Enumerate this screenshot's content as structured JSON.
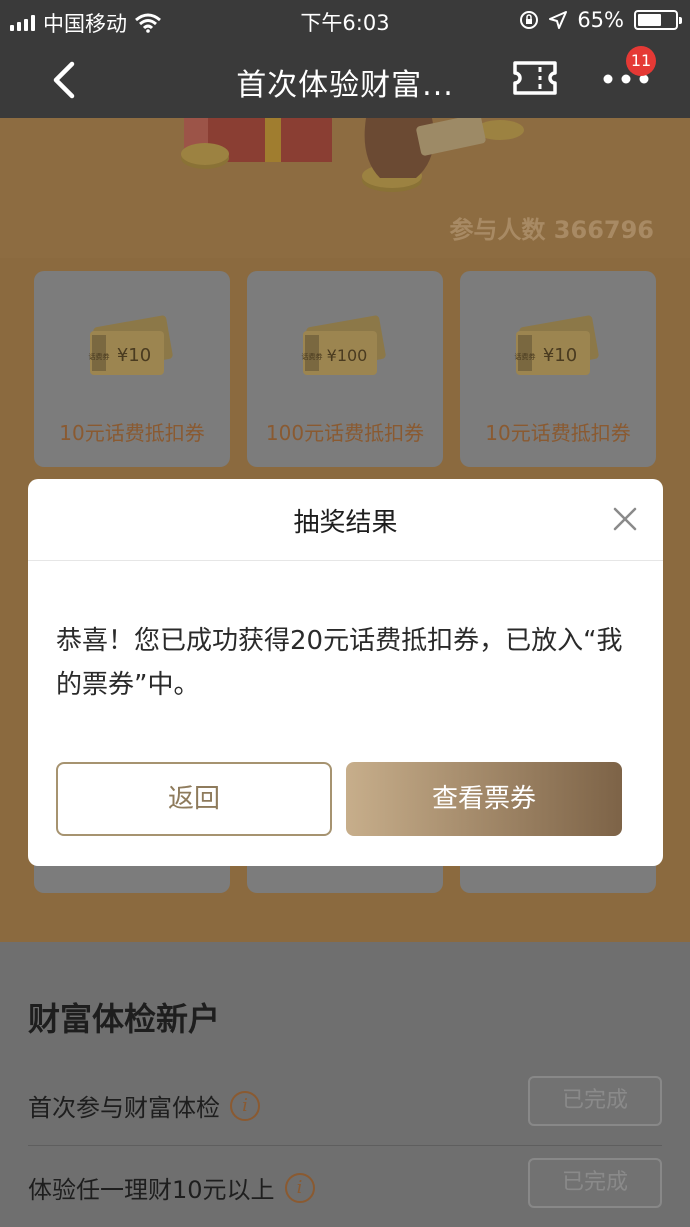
{
  "status_bar": {
    "carrier": "中国移动",
    "time": "下午6:03",
    "battery": "65%",
    "battery_level": 0.65
  },
  "nav": {
    "title": "首次体验财富...",
    "badge_count": "11"
  },
  "promo": {
    "participants": "参与人数 366796",
    "cards": [
      {
        "amount": "¥10",
        "label": "10元话费抵扣券"
      },
      {
        "amount": "¥100",
        "label": "100元话费抵扣券"
      },
      {
        "amount": "¥10",
        "label": "10元话费抵扣券"
      }
    ],
    "ticket_tag": "话费券"
  },
  "modal": {
    "title": "抽奖结果",
    "message": "恭喜！您已成功获得20元话费抵扣券，已放入“我的票券”中。",
    "back_label": "返回",
    "view_label": "查看票券"
  },
  "section": {
    "title": "财富体检新户",
    "tasks": [
      {
        "label": "首次参与财富体检",
        "status": "已完成"
      },
      {
        "label": "体验任一理财10元以上",
        "status": "已完成"
      }
    ]
  },
  "colors": {
    "accent_brown": "#8a5a31",
    "badge_red": "#e53935",
    "gold": "#c7ae8b"
  }
}
